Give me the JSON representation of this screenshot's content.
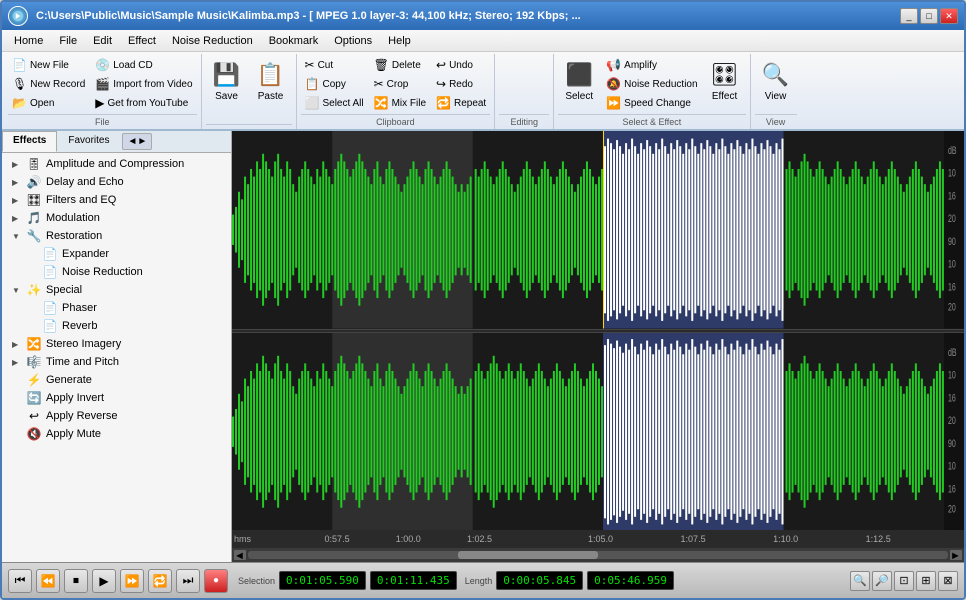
{
  "window": {
    "title": "C:\\Users\\Public\\Music\\Sample Music\\Kalimba.mp3 - [ MPEG 1.0 layer-3: 44,100 kHz; Stereo; 192 Kbps; ...",
    "icon": "audio-icon"
  },
  "menu": {
    "items": [
      "Home",
      "File",
      "Edit",
      "Effect",
      "Noise Reduction",
      "Bookmark",
      "Options",
      "Help"
    ]
  },
  "ribbon": {
    "groups": {
      "file": {
        "label": "File",
        "buttons": [
          "New File",
          "New Record",
          "Open",
          "Load CD",
          "Import from Video",
          "Get from YouTube"
        ]
      },
      "save": {
        "label": "",
        "buttons": [
          "Save",
          "Paste"
        ]
      },
      "clipboard": {
        "label": "Clipboard",
        "buttons": [
          "Cut",
          "Copy",
          "Select All",
          "Delete",
          "Crop",
          "Mix File",
          "Undo",
          "Redo",
          "Repeat"
        ]
      },
      "editing": {
        "label": "Editing"
      },
      "select": {
        "label": "Select & Effect",
        "buttons": [
          "Select",
          "Amplify",
          "Noise Reduction",
          "Speed Change",
          "Effect"
        ]
      },
      "view": {
        "label": "View",
        "buttons": [
          "View"
        ]
      }
    }
  },
  "sidebar": {
    "tabs": [
      "Effects",
      "Favorites"
    ],
    "tab_btn": "◄►",
    "tree": [
      {
        "level": 0,
        "arrow": "▶",
        "icon": "🎚",
        "label": "Amplitude and Compression"
      },
      {
        "level": 0,
        "arrow": "▶",
        "icon": "🔊",
        "label": "Delay and Echo"
      },
      {
        "level": 0,
        "arrow": "▶",
        "icon": "🎛",
        "label": "Filters and EQ"
      },
      {
        "level": 0,
        "arrow": "▶",
        "icon": "🎵",
        "label": "Modulation"
      },
      {
        "level": 0,
        "arrow": "▼",
        "icon": "🔧",
        "label": "Restoration"
      },
      {
        "level": 1,
        "arrow": "",
        "icon": "📄",
        "label": "Expander"
      },
      {
        "level": 1,
        "arrow": "",
        "icon": "📄",
        "label": "Noise Reduction"
      },
      {
        "level": 0,
        "arrow": "▼",
        "icon": "✨",
        "label": "Special"
      },
      {
        "level": 1,
        "arrow": "",
        "icon": "📄",
        "label": "Phaser"
      },
      {
        "level": 1,
        "arrow": "",
        "icon": "📄",
        "label": "Reverb"
      },
      {
        "level": 0,
        "arrow": "▶",
        "icon": "🔀",
        "label": "Stereo Imagery"
      },
      {
        "level": 0,
        "arrow": "▶",
        "icon": "🎼",
        "label": "Time and Pitch"
      },
      {
        "level": 0,
        "arrow": "",
        "icon": "⚡",
        "label": "Generate"
      },
      {
        "level": 0,
        "arrow": "",
        "icon": "🔄",
        "label": "Apply Invert"
      },
      {
        "level": 0,
        "arrow": "",
        "icon": "↩",
        "label": "Apply Reverse"
      },
      {
        "level": 0,
        "arrow": "",
        "icon": "🔇",
        "label": "Apply Mute"
      }
    ]
  },
  "timeline": {
    "labels": [
      "hms",
      "0:57.5",
      "1:00.0",
      "1:02.5",
      "1:05.0",
      "1:07.5",
      "1:10.0",
      "1:12.5"
    ]
  },
  "transport": {
    "buttons": [
      "⏮",
      "⏪",
      "⏹",
      "▶",
      "⏩",
      "⏺"
    ],
    "selection_label": "Selection",
    "selection_start": "0:01:05.590",
    "selection_end": "0:01:11.435",
    "length_label": "Length",
    "length": "0:00:05.845",
    "total": "0:05:46.959"
  },
  "db_scale": [
    "dB",
    "10",
    "16",
    "20",
    "90",
    "10",
    "16",
    "20",
    "90"
  ]
}
